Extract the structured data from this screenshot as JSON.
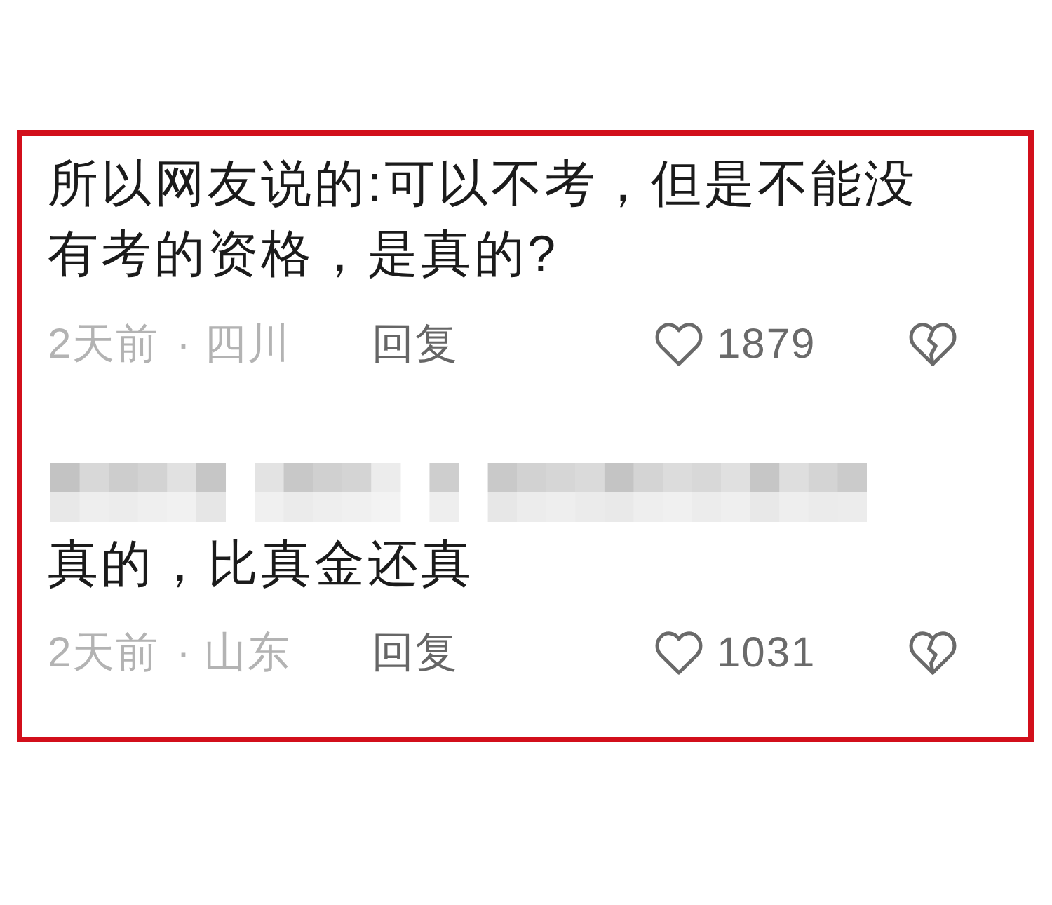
{
  "comments": [
    {
      "author_hidden": false,
      "text": "所以网友说的:可以不考，但是不能没有考的资格，是真的?",
      "time": "2天前",
      "separator": "·",
      "location": "四川",
      "reply": "回复",
      "likes": "1879"
    },
    {
      "author_hidden": true,
      "text": "真的，比真金还真",
      "time": "2天前",
      "separator": "·",
      "location": "山东",
      "reply": "回复",
      "likes": "1031"
    }
  ]
}
